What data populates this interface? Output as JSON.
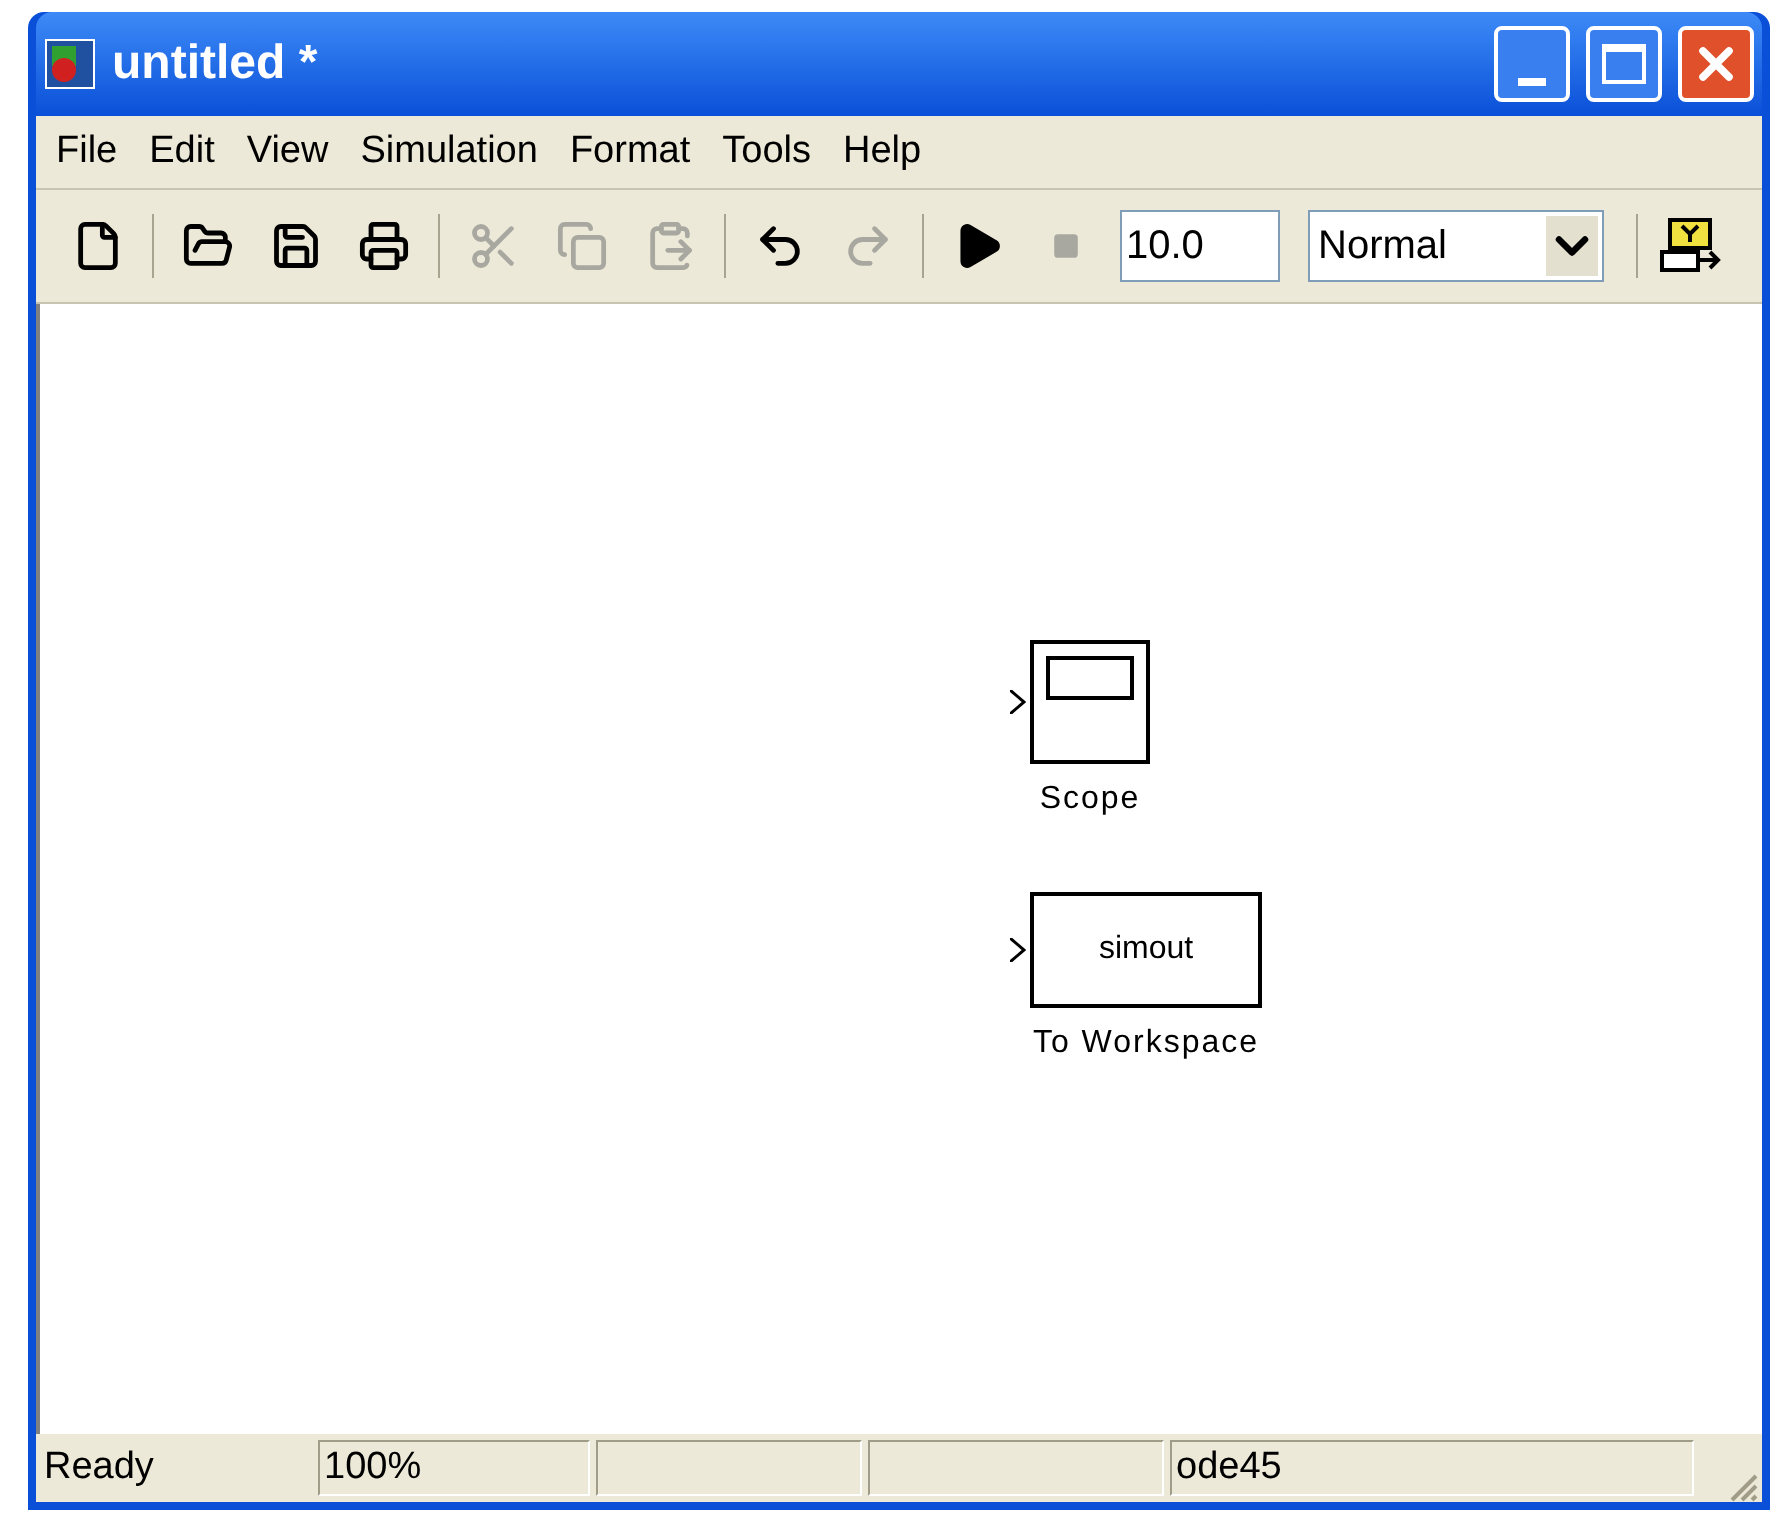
{
  "window": {
    "title": "untitled *"
  },
  "menu": [
    "File",
    "Edit",
    "View",
    "Simulation",
    "Format",
    "Tools",
    "Help"
  ],
  "toolbar": [
    {
      "kind": "new",
      "disabled": false
    },
    {
      "kind": "sep"
    },
    {
      "kind": "open",
      "disabled": false
    },
    {
      "kind": "save",
      "disabled": false
    },
    {
      "kind": "print",
      "disabled": false
    },
    {
      "kind": "sep"
    },
    {
      "kind": "cut",
      "disabled": true
    },
    {
      "kind": "copy",
      "disabled": true
    },
    {
      "kind": "paste",
      "disabled": true
    },
    {
      "kind": "sep"
    },
    {
      "kind": "undo",
      "disabled": false
    },
    {
      "kind": "redo",
      "disabled": true
    },
    {
      "kind": "sep"
    },
    {
      "kind": "play",
      "disabled": false
    },
    {
      "kind": "stop",
      "disabled": true
    }
  ],
  "stop_time": {
    "value": "10.0"
  },
  "mode": {
    "value": "Normal"
  },
  "blocks": [
    {
      "kind": "scope",
      "label": "Scope"
    },
    {
      "kind": "workspace",
      "text": "simout",
      "label": "To Workspace"
    }
  ],
  "status_bar": [
    {
      "kind": "text",
      "text": "Ready"
    },
    {
      "kind": "text",
      "text": "100%"
    },
    {
      "kind": "blank"
    },
    {
      "kind": "blank"
    },
    {
      "kind": "text",
      "text": "ode45"
    }
  ]
}
